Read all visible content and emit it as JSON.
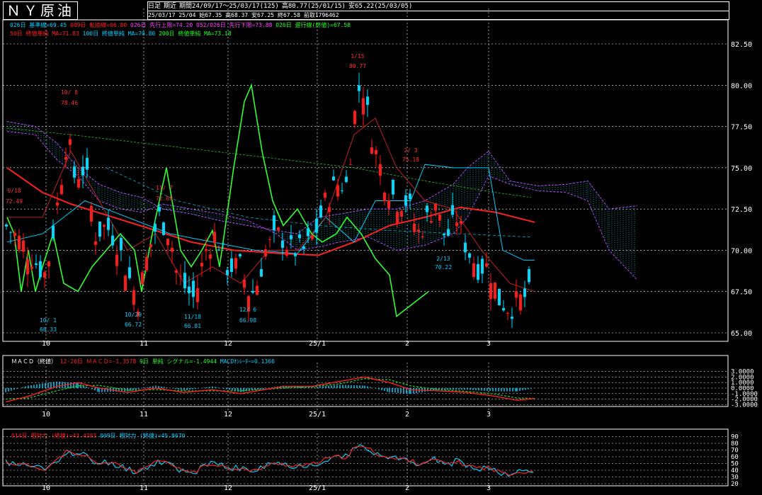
{
  "title": "ＮＹ原油",
  "header": {
    "mode": "日足",
    "contract": "期近",
    "period": "期間24/09/17～25/03/17(125)",
    "high": "高80.77(25/01/15)",
    "low": "安65.22(25/03/05)",
    "ohlc": "25/03/17 25/04 始67.35 高68.37 安67.25 終67.58 前取1796462"
  },
  "legend": {
    "row1": [
      {
        "text": "026日 基準線=69.45",
        "color": "#00d0ff"
      },
      {
        "text": "009日 転換線=66.80",
        "color": "#ff2020"
      },
      {
        "text": "026日 先行上限=74.20",
        "color": "#ff40ff"
      },
      {
        "text": "052/026日 先行下限=73.88",
        "color": "#ff40ff"
      },
      {
        "text": "026日 遅行線(終値)=67.58",
        "color": "#20ff20"
      }
    ],
    "row2": [
      {
        "text": "50日 終値単純 MA=71.83",
        "color": "#ff2020"
      },
      {
        "text": "100日 終値単純 MA=70.80",
        "color": "#00d0ff"
      },
      {
        "text": "200日 終値単純 MA=73.18",
        "color": "#20ff20"
      }
    ]
  },
  "y_axis_price": [
    "82.50",
    "80.00",
    "77.50",
    "75.00",
    "72.50",
    "70.00",
    "67.50",
    "65.00"
  ],
  "x_axis": [
    "10",
    "11",
    "12",
    "25/1",
    "2",
    "3"
  ],
  "annotations": [
    {
      "date": "9/18",
      "value": "72.49",
      "color": "#ff3030"
    },
    {
      "date": "10/ 8",
      "value": "78.46",
      "color": "#ff3030"
    },
    {
      "date": "10/ 1",
      "value": "68.33",
      "color": "#00d0ff"
    },
    {
      "date": "10/29",
      "value": "66.72",
      "color": "#00d0ff"
    },
    {
      "date": "11/ 7",
      "value": "72.88",
      "color": "#ff3030"
    },
    {
      "date": "11/18",
      "value": "66.81",
      "color": "#00d0ff"
    },
    {
      "date": "12/ 6",
      "value": "66.98",
      "color": "#00d0ff"
    },
    {
      "date": "1/15",
      "value": "80.77",
      "color": "#ff3030"
    },
    {
      "date": "2/ 3",
      "value": "75.18",
      "color": "#ff3030"
    },
    {
      "date": "2/13",
      "value": "70.22",
      "color": "#00d0ff"
    }
  ],
  "macd": {
    "title": "ＭＡＣＤ（終値）",
    "macd_label": "12-26日 ＭＡＣＤ=-1.3578",
    "signal_label": "9日 単純 シグナル=-1.4944",
    "osc_label": "MACDｵｼﾚｰﾀｰ=0.1366",
    "y_axis": [
      "3.0000",
      "2.0000",
      "1.0000",
      "0.0000",
      "-1.0000",
      "-2.0000",
      "-3.0000"
    ]
  },
  "rsi": {
    "label14": "014日 相対力 (終値)=43.4283",
    "label9": "009日 相対力 (終値)=45.8670",
    "y_axis": [
      "90",
      "80",
      "70",
      "60",
      "50",
      "40",
      "30",
      "20"
    ]
  },
  "colors": {
    "up": "#ff1a1a",
    "down": "#00d8ff",
    "grid": "#ffffff",
    "cloud": "#00c8c8",
    "span": "#c040ff"
  }
}
